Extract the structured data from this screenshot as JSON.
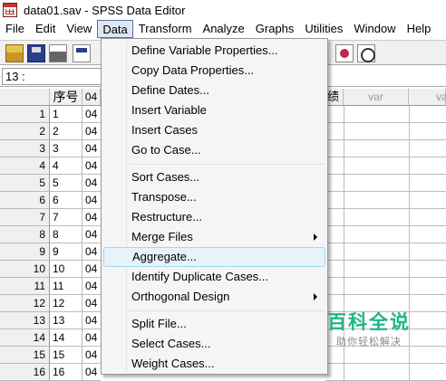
{
  "window": {
    "title": "data01.sav - SPSS Data Editor",
    "icon": "spss-data-icon"
  },
  "menubar": [
    {
      "label": "File"
    },
    {
      "label": "Edit"
    },
    {
      "label": "View"
    },
    {
      "label": "Data",
      "active": true
    },
    {
      "label": "Transform"
    },
    {
      "label": "Analyze"
    },
    {
      "label": "Graphs"
    },
    {
      "label": "Utilities"
    },
    {
      "label": "Window"
    },
    {
      "label": "Help"
    }
  ],
  "toolbar": {
    "icons": [
      "open-file-icon",
      "save-icon",
      "print-icon",
      "dialog-recall-icon",
      "value-labels-icon",
      "use-sets-icon"
    ]
  },
  "cell_ref": "13 :",
  "grid": {
    "columns": [
      "序号",
      "04",
      "绩",
      "var",
      "var"
    ],
    "rows": [
      {
        "n": "1",
        "a": "1",
        "b": "04"
      },
      {
        "n": "2",
        "a": "2",
        "b": "04"
      },
      {
        "n": "3",
        "a": "3",
        "b": "04"
      },
      {
        "n": "4",
        "a": "4",
        "b": "04"
      },
      {
        "n": "5",
        "a": "5",
        "b": "04"
      },
      {
        "n": "6",
        "a": "6",
        "b": "04"
      },
      {
        "n": "7",
        "a": "7",
        "b": "04"
      },
      {
        "n": "8",
        "a": "8",
        "b": "04"
      },
      {
        "n": "9",
        "a": "9",
        "b": "04"
      },
      {
        "n": "10",
        "a": "10",
        "b": "04"
      },
      {
        "n": "11",
        "a": "11",
        "b": "04"
      },
      {
        "n": "12",
        "a": "12",
        "b": "04"
      },
      {
        "n": "13",
        "a": "13",
        "b": "04"
      },
      {
        "n": "14",
        "a": "14",
        "b": "04"
      },
      {
        "n": "15",
        "a": "15",
        "b": "04"
      },
      {
        "n": "16",
        "a": "16",
        "b": "04"
      }
    ]
  },
  "data_menu": {
    "items": [
      {
        "label": "Define Variable Properties..."
      },
      {
        "label": "Copy Data Properties..."
      },
      {
        "label": "Define Dates..."
      },
      {
        "label": "Insert Variable"
      },
      {
        "label": "Insert Cases"
      },
      {
        "label": "Go to Case..."
      },
      {
        "label": "Sort Cases..."
      },
      {
        "label": "Transpose..."
      },
      {
        "label": "Restructure..."
      },
      {
        "label": "Merge Files",
        "submenu": true
      },
      {
        "label": "Aggregate...",
        "highlighted": true
      },
      {
        "label": "Identify Duplicate Cases..."
      },
      {
        "label": "Orthogonal Design",
        "submenu": true
      },
      {
        "label": "Split File..."
      },
      {
        "label": "Select Cases..."
      },
      {
        "label": "Weight Cases..."
      }
    ]
  },
  "watermark": {
    "title": "百科全说",
    "subtitle": "助你轻松解决"
  }
}
